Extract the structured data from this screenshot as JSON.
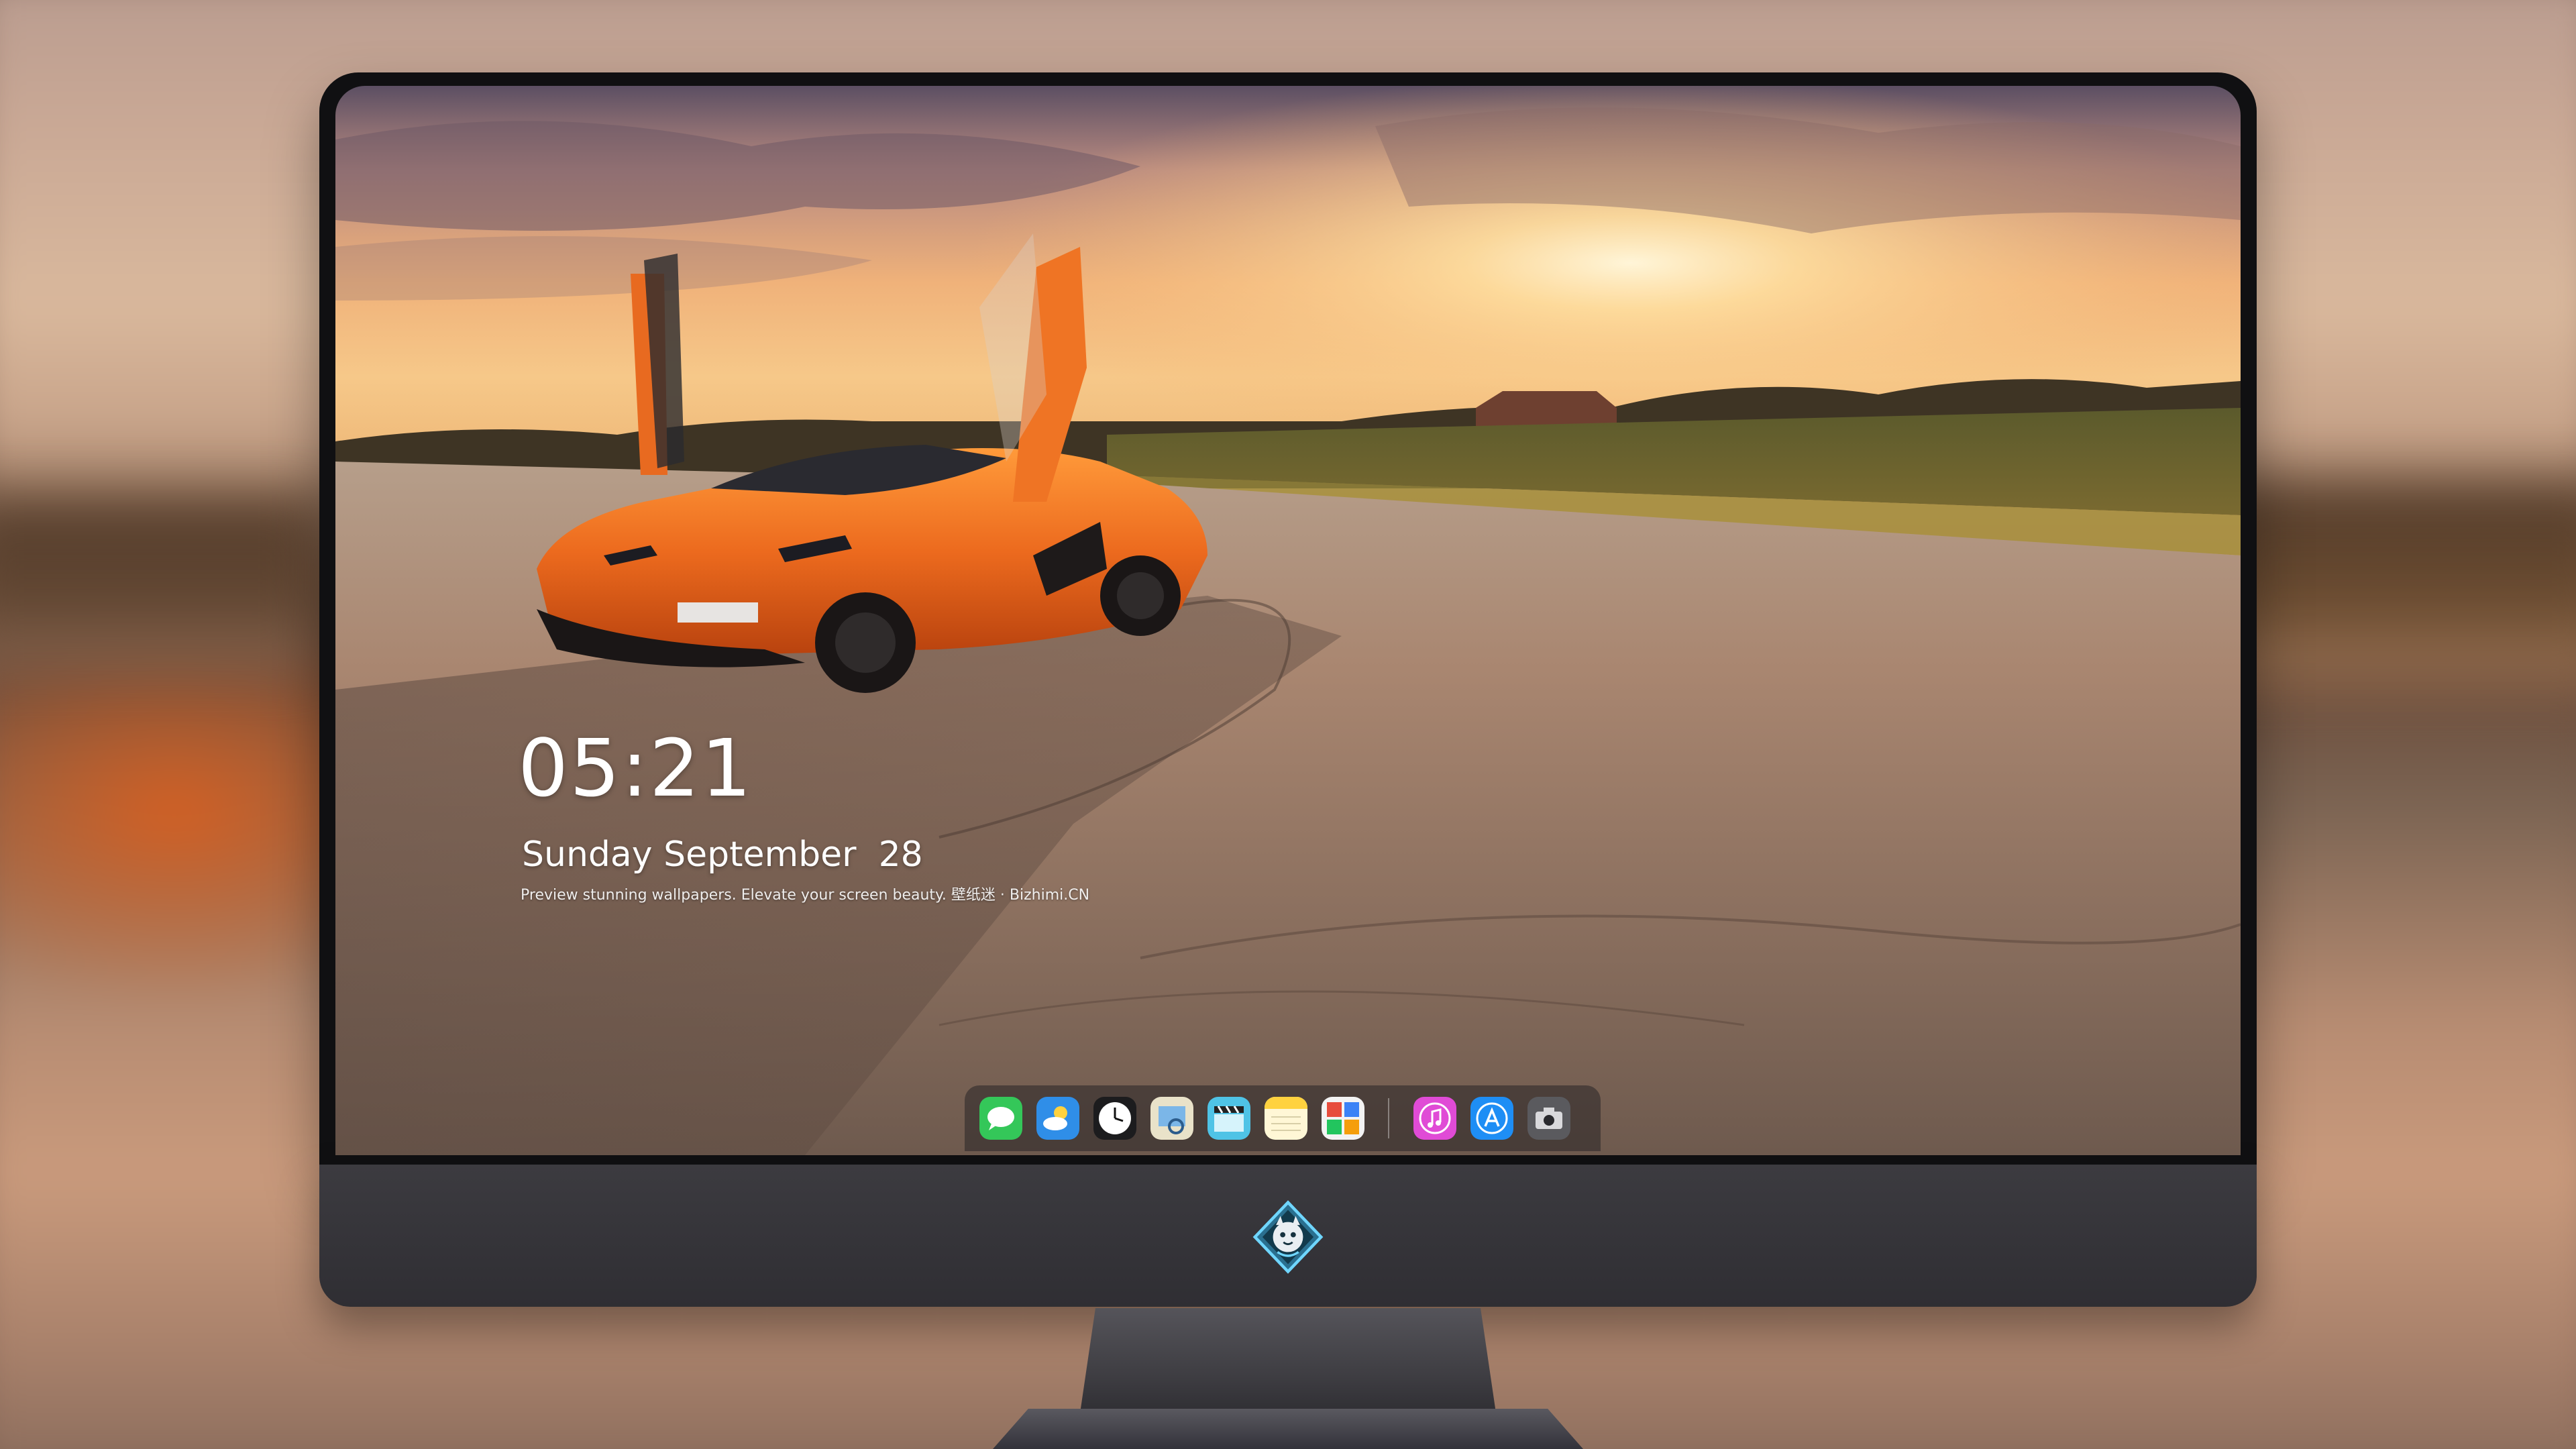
{
  "lockscreen": {
    "time": "05:21",
    "date": "Sunday September  28",
    "tagline": "Preview stunning wallpapers. Elevate your screen beauty. 壁纸迷 · Bizhimi.CN"
  },
  "dock": {
    "apps": [
      {
        "name": "Messages",
        "icon": "messages-icon"
      },
      {
        "name": "Weather",
        "icon": "weather-icon"
      },
      {
        "name": "Clock",
        "icon": "clock-icon"
      },
      {
        "name": "Preview",
        "icon": "preview-icon"
      },
      {
        "name": "Clips",
        "icon": "clapperboard-icon"
      },
      {
        "name": "Notes",
        "icon": "notes-icon"
      },
      {
        "name": "Photo Booth",
        "icon": "photo-booth-icon"
      }
    ],
    "secondary_apps": [
      {
        "name": "iTunes",
        "icon": "music-note-icon"
      },
      {
        "name": "App Store",
        "icon": "app-store-icon"
      },
      {
        "name": "Camera",
        "icon": "camera-icon"
      }
    ]
  },
  "monitor": {
    "logo": "dragon-mascot-logo"
  },
  "colors": {
    "car_orange": "#e8641c",
    "sky_glow": "#ffd79a",
    "bezel": "#101012",
    "chin": "#36353a"
  }
}
